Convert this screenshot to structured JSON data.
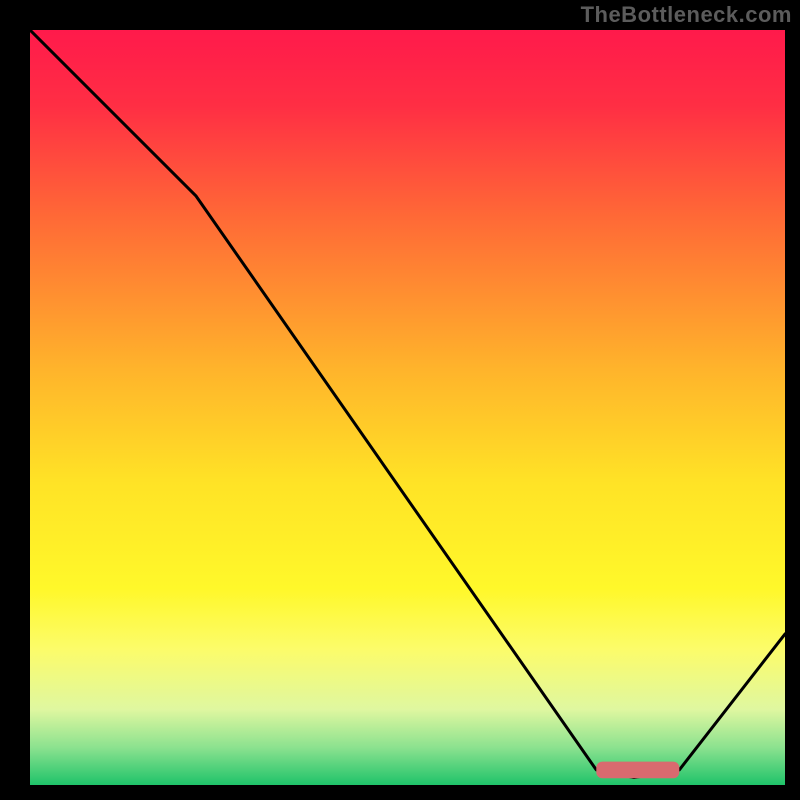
{
  "watermark": "TheBottleneck.com",
  "chart_data": {
    "type": "line",
    "title": "",
    "xlabel": "",
    "ylabel": "",
    "xlim": [
      0,
      100
    ],
    "ylim": [
      0,
      100
    ],
    "grid": false,
    "legend": false,
    "annotations": [],
    "gradient_stops": [
      {
        "offset": 0.0,
        "color": "#ff1a4b"
      },
      {
        "offset": 0.1,
        "color": "#ff2e44"
      },
      {
        "offset": 0.25,
        "color": "#ff6a36"
      },
      {
        "offset": 0.45,
        "color": "#ffb42b"
      },
      {
        "offset": 0.6,
        "color": "#ffe326"
      },
      {
        "offset": 0.74,
        "color": "#fff82a"
      },
      {
        "offset": 0.82,
        "color": "#fcfc6a"
      },
      {
        "offset": 0.9,
        "color": "#dff7a0"
      },
      {
        "offset": 0.95,
        "color": "#8ce28f"
      },
      {
        "offset": 1.0,
        "color": "#1fc36a"
      }
    ],
    "series": [
      {
        "name": "bottleneck-curve",
        "x": [
          0,
          22,
          75,
          80,
          86,
          100
        ],
        "values": [
          100,
          78,
          2,
          1,
          2,
          20
        ]
      }
    ],
    "highlight_bar": {
      "x_start": 75,
      "x_end": 86,
      "y": 2,
      "color": "#d96a6f",
      "thickness": 2.2
    }
  }
}
